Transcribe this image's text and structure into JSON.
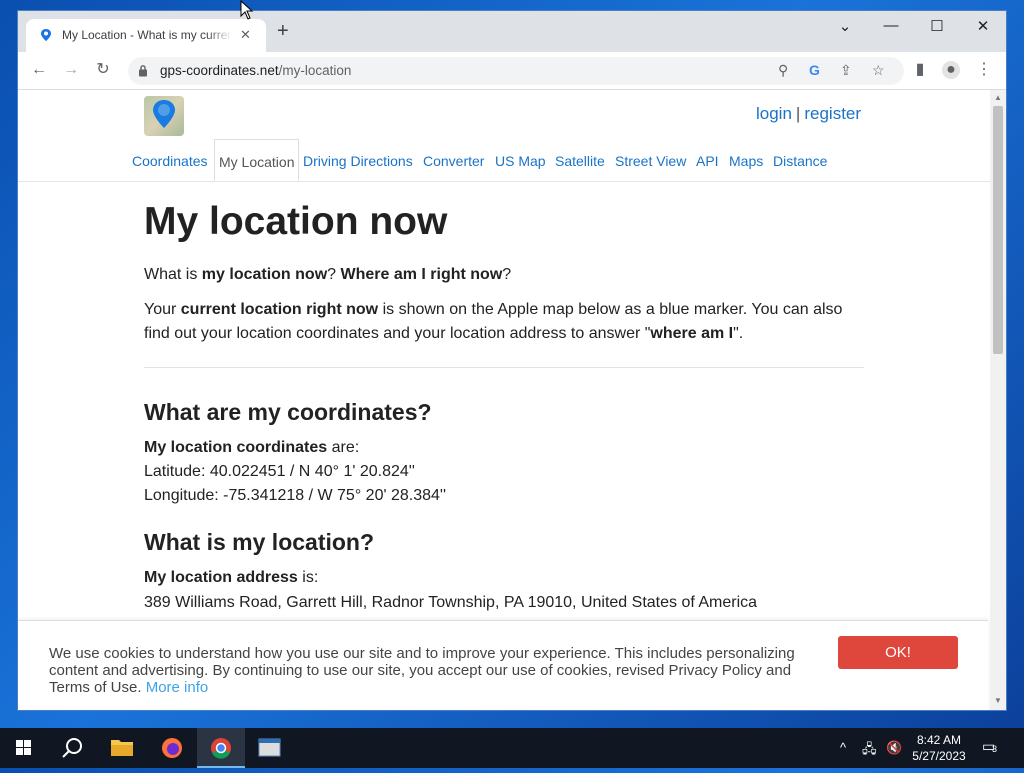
{
  "browser": {
    "tab_title": "My Location - What is my current location",
    "url_domain": "gps-coordinates.net",
    "url_path": "/my-location"
  },
  "site": {
    "login": "login",
    "separator": "|",
    "register": "register",
    "nav": [
      "Coordinates",
      "My Location",
      "Driving Directions",
      "Converter",
      "US Map",
      "Satellite",
      "Street View",
      "API",
      "Maps",
      "Distance"
    ],
    "active_nav": "My Location"
  },
  "page": {
    "h1": "My location now",
    "q_pre": "What is ",
    "q_b1": "my location now",
    "q_mid": "? ",
    "q_b2": "Where am I right now",
    "q_end": "?",
    "intro_pre": "Your ",
    "intro_b": "current location right now",
    "intro_mid": " is shown on the Apple map below as a blue marker. You can also find out your location coordinates and your location address to answer \"",
    "intro_b2": "where am I",
    "intro_end": "\".",
    "h2_coords": "What are my coordinates?",
    "coords_label_b": "My location coordinates",
    "coords_label_end": " are:",
    "latitude": "Latitude: 40.022451 / N 40° 1' 20.824''",
    "longitude": "Longitude: -75.341218 / W 75° 20' 28.384''",
    "h2_location": "What is my location?",
    "address_label_b": "My location address",
    "address_label_end": " is:",
    "address": "389 Williams Road, Garrett Hill, Radnor Township, PA 19010, United States of America"
  },
  "cookie": {
    "text": "We use cookies to understand how you use our site and to improve your experience. This includes personalizing content and advertising. By continuing to use our site, you accept our use of cookies, revised Privacy Policy and Terms of Use.",
    "more_info": "More info",
    "ok": "OK!"
  },
  "taskbar": {
    "time": "8:42 AM",
    "date": "5/27/2023",
    "notifications": "3"
  },
  "colors": {
    "link": "#1a73c8",
    "ok_button": "#e0473c",
    "desktop": "#1a73d9",
    "taskbar": "#101722"
  }
}
